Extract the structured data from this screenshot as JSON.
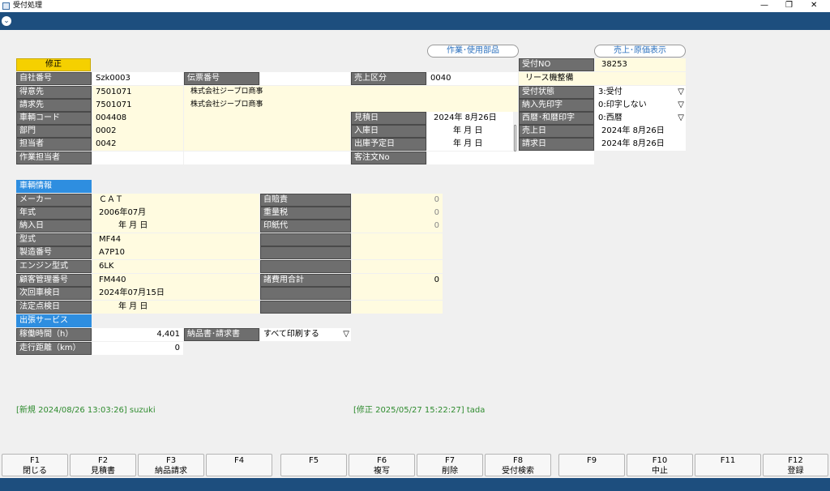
{
  "window": {
    "title": "受付処理",
    "controls": [
      "—",
      "❐",
      "✕"
    ]
  },
  "mode_label": "修正",
  "top_buttons": {
    "parts": "作業･使用部品",
    "cost": "売上･原価表示"
  },
  "header": {
    "self_no_label": "自社番号",
    "self_no": "Szk0003",
    "slip_label": "伝票番号",
    "slip": "",
    "sales_div_label": "売上区分",
    "sales_div": "0040",
    "customer_label": "得意先",
    "customer_code": "7501071",
    "customer_name": "株式会社ジープロ商事",
    "billing_label": "請求先",
    "billing_code": "7501071",
    "billing_name": "株式会社ジープロ商事",
    "vehicle_code_label": "車輌コード",
    "vehicle_code": "004408",
    "dept_label": "部門",
    "dept": "0002",
    "staff_label": "担当者",
    "staff": "0042",
    "worker_label": "作業担当者",
    "worker": "",
    "estimate_label": "見積日",
    "estimate": "2024年  8月26日",
    "in_label": "入庫日",
    "in_date": "年    月    日",
    "out_label": "出庫予定日",
    "out_date": "年    月    日",
    "order_label": "客注文No",
    "order": ""
  },
  "right": {
    "recv_no_label": "受付NO",
    "recv_no": "38253",
    "lease_label": "リース機整備",
    "status_label": "受付状態",
    "status": "3:受付",
    "print_dest_label": "納入先印字",
    "print_dest": "0:印字しない",
    "era_label": "西暦･和暦印字",
    "era": "0:西暦",
    "sales_date_label": "売上日",
    "sales_date": "2024年  8月26日",
    "bill_date_label": "請求日",
    "bill_date": "2024年  8月26日"
  },
  "vehicle": {
    "section": "車輌情報",
    "maker_label": "メーカー",
    "maker": "ＣＡＴ",
    "year_label": "年式",
    "year": "2006年07月",
    "delivery_label": "納入日",
    "delivery": "年    月    日",
    "model_label": "型式",
    "model": "MF44",
    "serial_label": "製造番号",
    "serial": "A7P10",
    "engine_label": "エンジン型式",
    "engine": "6LK",
    "cust_mgmt_label": "顧客管理番号",
    "cust_mgmt": "FM440",
    "next_insp_label": "次回車検日",
    "next_insp": "2024年07月15日",
    "legal_insp_label": "法定点検日",
    "legal_insp": "年    月    日",
    "insurance_label": "自賠責",
    "insurance": "0",
    "weight_tax_label": "重量税",
    "weight_tax": "0",
    "stamp_label": "印紙代",
    "stamp": "0",
    "fees_total_label": "諸費用合計",
    "fees_total": "0"
  },
  "service": {
    "section": "出張サービス",
    "hours_label": "稼働時間（h）",
    "hours": "4,401",
    "distance_label": "走行距離（km）",
    "distance": "0",
    "invoice_label": "納品書･請求書",
    "invoice": "すべて印刷する"
  },
  "footer_info": {
    "created": "[新規 2024/08/26 13:03:26] suzuki",
    "modified": "[修正 2025/05/27 15:22:27] tada"
  },
  "fkeys": [
    {
      "key": "F1",
      "label": "閉じる"
    },
    {
      "key": "F2",
      "label": "見積書"
    },
    {
      "key": "F3",
      "label": "納品請求"
    },
    {
      "key": "F4",
      "label": ""
    },
    {
      "key": "F5",
      "label": ""
    },
    {
      "key": "F6",
      "label": "複写"
    },
    {
      "key": "F7",
      "label": "削除"
    },
    {
      "key": "F8",
      "label": "受付検索"
    },
    {
      "key": "F9",
      "label": ""
    },
    {
      "key": "F10",
      "label": "中止"
    },
    {
      "key": "F11",
      "label": ""
    },
    {
      "key": "F12",
      "label": "登録"
    }
  ],
  "colors": {
    "titlebar_blue": "#1d4e7e",
    "section_blue": "#2e8ee0",
    "mode_yellow": "#f5d000",
    "label_grey": "#6e6e6e"
  }
}
